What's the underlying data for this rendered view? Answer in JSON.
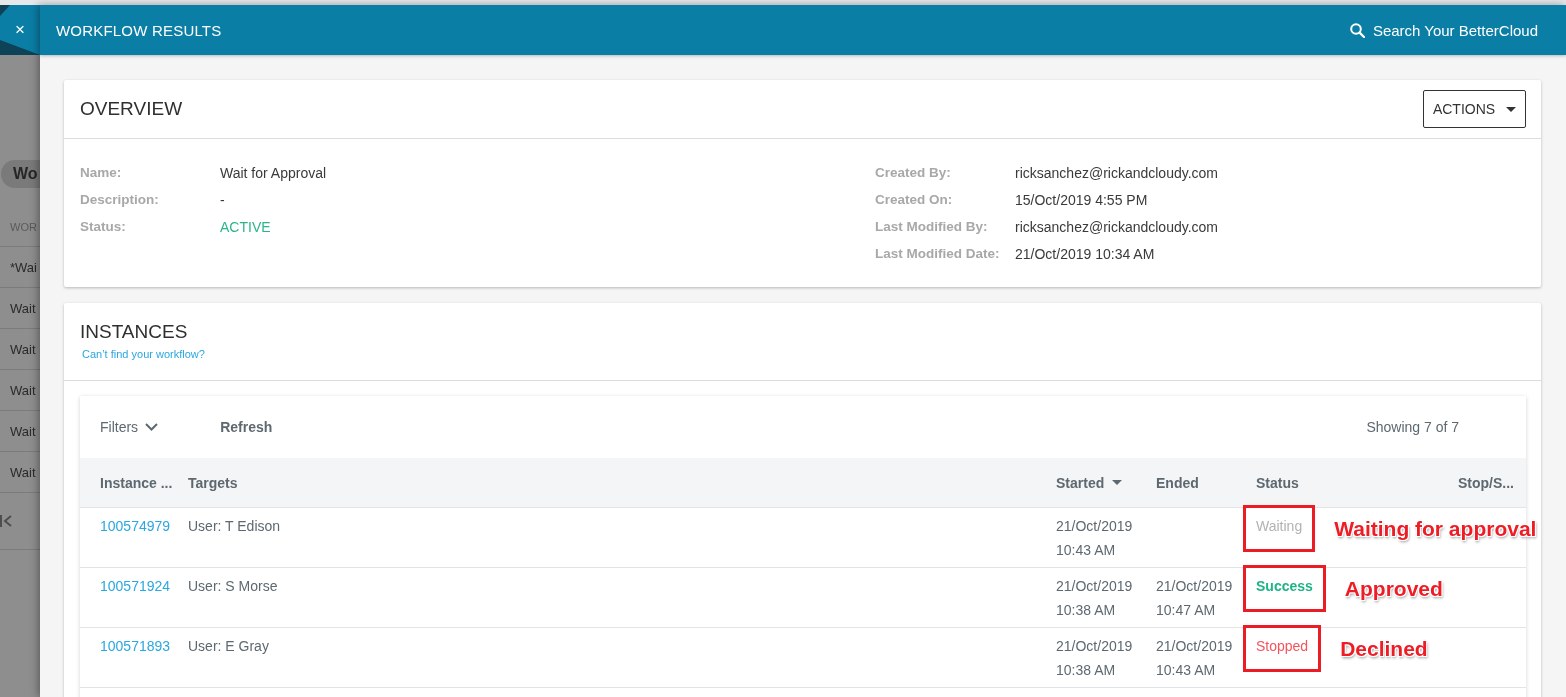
{
  "background_page": {
    "chip": "Wo",
    "column_heading": "WOR",
    "rows": [
      "*Wai",
      "Wait",
      "Wait",
      "Wait",
      "Wait",
      "Wait"
    ]
  },
  "header": {
    "close": "×",
    "title": "WORKFLOW RESULTS",
    "search": "Search Your BetterCloud"
  },
  "overview": {
    "title": "OVERVIEW",
    "actions": "ACTIONS",
    "details_left": [
      {
        "label": "Name:",
        "value": "Wait for Approval",
        "kind": "text"
      },
      {
        "label": "Description:",
        "value": "-",
        "kind": "text"
      },
      {
        "label": "Status:",
        "value": "ACTIVE",
        "kind": "status"
      }
    ],
    "details_right": [
      {
        "label": "Created By:",
        "value": "ricksanchez@rickandcloudy.com",
        "kind": "text"
      },
      {
        "label": "Created On:",
        "value": "15/Oct/2019 4:55 PM",
        "kind": "text"
      },
      {
        "label": "Last Modified By:",
        "value": "ricksanchez@rickandcloudy.com",
        "kind": "text"
      },
      {
        "label": "Last Modified Date:",
        "value": "21/Oct/2019 10:34 AM",
        "kind": "text"
      }
    ]
  },
  "instances": {
    "title": "INSTANCES",
    "help_link": "Can’t find your workflow?",
    "filters": "Filters",
    "refresh": "Refresh",
    "count": "Showing 7 of 7",
    "columns": [
      {
        "label": "Instance ...",
        "sorted": false
      },
      {
        "label": "Targets",
        "sorted": false
      },
      {
        "label": "Started",
        "sorted": true
      },
      {
        "label": "Ended",
        "sorted": false
      },
      {
        "label": "Status",
        "sorted": false
      },
      {
        "label": "Stop/S...",
        "sorted": false
      }
    ],
    "rows": [
      {
        "instance": "100574979",
        "target": "User: T Edison",
        "started": "21/Oct/2019 10:43 AM",
        "status": {
          "label": "Waiting",
          "kind": "waiting"
        },
        "highlighted": true,
        "note": "Waiting for approval"
      },
      {
        "instance": "100571924",
        "target": "User: S Morse",
        "started": "21/Oct/2019 10:38 AM",
        "ended": "21/Oct/2019 10:47 AM",
        "status": {
          "label": "Success",
          "kind": "success"
        },
        "highlighted": true,
        "note": "Approved"
      },
      {
        "instance": "100571893",
        "target": "User: E Gray",
        "started": "21/Oct/2019 10:38 AM",
        "ended": "21/Oct/2019 10:43 AM",
        "status": {
          "label": "Stopped",
          "kind": "stopped"
        },
        "highlighted": true,
        "note": "Declined"
      }
    ]
  }
}
